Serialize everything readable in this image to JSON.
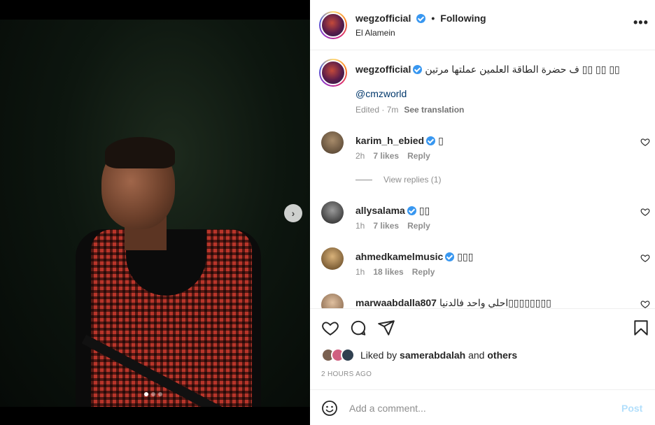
{
  "post": {
    "username": "wegzofficial",
    "following": "Following",
    "dot": "•",
    "location": "El Alamein",
    "more": "•••"
  },
  "caption": {
    "username": "wegzofficial",
    "text": "ف حضرة الطاقة العلمين عملتها مرتين ▯▯ ▯▯ ▯▯",
    "mention": "@cmzworld",
    "time": "Edited · 7m",
    "see_translation": "See translation"
  },
  "comments": [
    {
      "username": "karim_h_ebied",
      "text": "▯",
      "time": "2h",
      "likes": "7 likes",
      "reply": "Reply",
      "avatar_color": "#6a5a4a"
    },
    {
      "username": "allysalama",
      "text": "▯▯",
      "time": "1h",
      "likes": "7 likes",
      "reply": "Reply",
      "avatar_color": "#3a3a3a"
    },
    {
      "username": "ahmedkamelmusic",
      "text": "▯▯▯",
      "time": "1h",
      "likes": "18 likes",
      "reply": "Reply",
      "avatar_color": "#8a6a3a"
    },
    {
      "username": "marwaabdalla807",
      "text": "احلي واحد فالدنيا▯▯▯▯▯▯▯▯",
      "time": "",
      "likes": "",
      "reply": "",
      "avatar_color": "#b58a6a"
    }
  ],
  "view_replies": "View replies (1)",
  "likes": {
    "prefix": "Liked by",
    "user": "samerabdalah",
    "and": "and",
    "others": "others"
  },
  "timestamp": "2 HOURS AGO",
  "add_comment": {
    "placeholder": "Add a comment...",
    "post_label": "Post"
  },
  "colors": {
    "verified": "#3897f0",
    "link": "#00376b",
    "post_disabled": "#b2dffc"
  },
  "icons": [
    "verified-badge-icon",
    "more-options-icon",
    "heart-icon",
    "comment-icon",
    "share-icon",
    "bookmark-icon",
    "emoji-icon",
    "next-arrow-icon"
  ]
}
